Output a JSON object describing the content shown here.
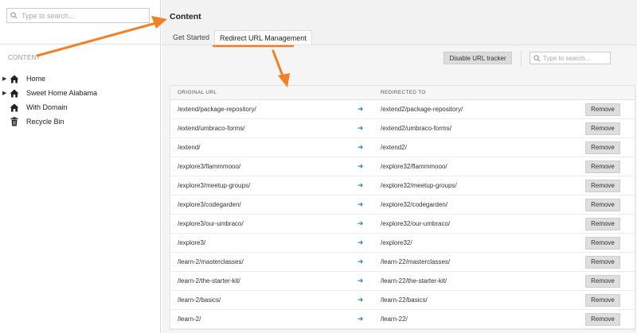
{
  "sidebar": {
    "search_placeholder": "Type to search...",
    "section_label": "CONTENT",
    "tree": [
      {
        "label": "Home",
        "icon": "home-icon",
        "expandable": true
      },
      {
        "label": "Sweet Home Alabama",
        "icon": "home-icon",
        "expandable": true
      },
      {
        "label": "With Domain",
        "icon": "home-icon",
        "expandable": false
      },
      {
        "label": "Recycle Bin",
        "icon": "trash-icon",
        "expandable": false
      }
    ]
  },
  "main": {
    "title": "Content",
    "tabs": [
      {
        "label": "Get Started",
        "active": false
      },
      {
        "label": "Redirect URL Management",
        "active": true
      }
    ],
    "toolbar": {
      "disable_label": "Disable URL tracker",
      "search_placeholder": "Type to search..."
    },
    "table": {
      "headers": {
        "original": "ORIGINAL URL",
        "redirected": "REDIRECTED TO"
      },
      "remove_label": "Remove",
      "rows": [
        {
          "original": "/extend/package-repository/",
          "redirected": "/extend2/package-repository/"
        },
        {
          "original": "/extend/umbraco-forms/",
          "redirected": "/extend2/umbraco-forms/"
        },
        {
          "original": "/extend/",
          "redirected": "/extend2/"
        },
        {
          "original": "/explore3/flammmooo/",
          "redirected": "/explore32/flammmooo/"
        },
        {
          "original": "/explore3/meetup-groups/",
          "redirected": "/explore32/meetup-groups/"
        },
        {
          "original": "/explore3/codegarden/",
          "redirected": "/explore32/codegarden/"
        },
        {
          "original": "/explore3/our-umbraco/",
          "redirected": "/explore32/our-umbraco/"
        },
        {
          "original": "/explore3/",
          "redirected": "/explore32/"
        },
        {
          "original": "/learn-2/masterclasses/",
          "redirected": "/learn-22/masterclasses/"
        },
        {
          "original": "/learn-2/the-starter-kit/",
          "redirected": "/learn-22/the-starter-kit/"
        },
        {
          "original": "/learn-2/basics/",
          "redirected": "/learn-22/basics/"
        },
        {
          "original": "/learn-2/",
          "redirected": "/learn-22/"
        }
      ]
    }
  },
  "colors": {
    "accent": "#f37f26",
    "arrow": "#2f7fbd"
  }
}
